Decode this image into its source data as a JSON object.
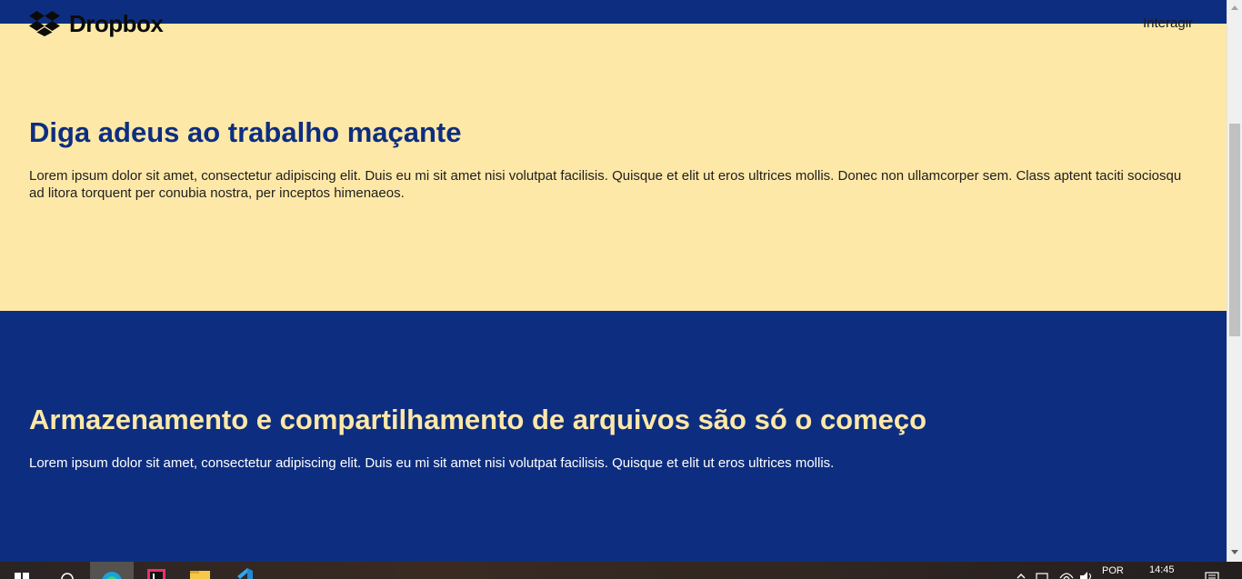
{
  "header": {
    "logo_text": "Dropbox",
    "nav_link": "Interagir"
  },
  "section_1": {
    "heading": "Diga adeus ao trabalho maçante",
    "paragraph": "Lorem ipsum dolor sit amet, consectetur adipiscing elit. Duis eu mi sit amet nisi volutpat facilisis. Quisque et elit ut eros ultrices mollis. Donec non ullamcorper sem. Class aptent taciti sociosqu ad litora torquent per conubia nostra, per inceptos himenaeos."
  },
  "section_2": {
    "heading": "Armazenamento e compartilhamento de arquivos são só o começo",
    "paragraph": "Lorem ipsum dolor sit amet, consectetur adipiscing elit. Duis eu mi sit amet nisi volutpat facilisis. Quisque et elit ut eros ultrices mollis."
  },
  "taskbar": {
    "language": "POR",
    "time": "14:45",
    "pinned_apps": [
      "start-icon",
      "search-icon",
      "edge-browser-icon",
      "intellij-icon",
      "file-explorer-icon",
      "vscode-icon"
    ]
  },
  "colors": {
    "navy": "#0d2e80",
    "cream": "#fee8a8",
    "white": "#ffffff"
  }
}
